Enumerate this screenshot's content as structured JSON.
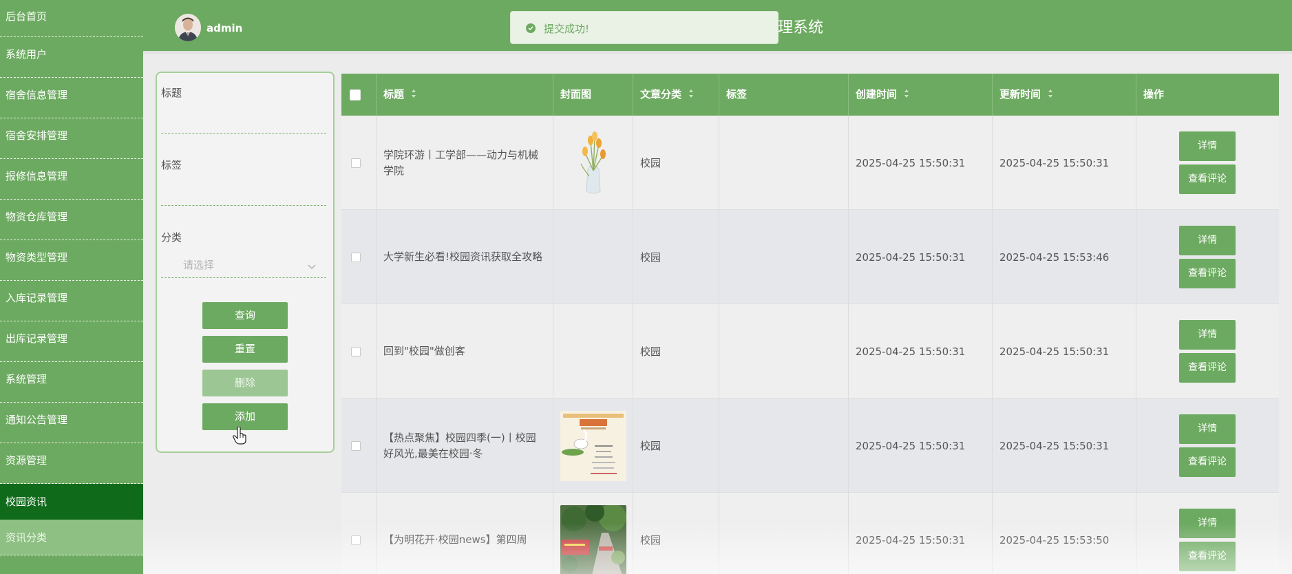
{
  "sidebar": {
    "items": [
      {
        "label": "后台首页"
      },
      {
        "label": "系统用户"
      },
      {
        "label": "宿舍信息管理"
      },
      {
        "label": "宿舍安排管理"
      },
      {
        "label": "报修信息管理"
      },
      {
        "label": "物资仓库管理"
      },
      {
        "label": "物资类型管理"
      },
      {
        "label": "入库记录管理"
      },
      {
        "label": "出库记录管理"
      },
      {
        "label": "系统管理"
      },
      {
        "label": "通知公告管理"
      },
      {
        "label": "资源管理"
      },
      {
        "label": "校园资讯"
      },
      {
        "label": "资讯分类"
      }
    ]
  },
  "header": {
    "username": "admin",
    "system_title": "理系统",
    "accent_color": "#6daa61"
  },
  "toast": {
    "message": "提交成功!",
    "type": "success"
  },
  "search": {
    "title_label": "标题",
    "tag_label": "标签",
    "category_label": "分类",
    "category_placeholder": "请选择",
    "buttons": {
      "query": "查询",
      "reset": "重置",
      "delete": "删除",
      "add": "添加"
    }
  },
  "table": {
    "columns": [
      "标题",
      "封面图",
      "文章分类",
      "标签",
      "创建时间",
      "更新时间",
      "操作"
    ],
    "rows": [
      {
        "title": "学院环游丨工学部——动力与机械学院",
        "cover": "tulip-vase",
        "category": "校园",
        "tag": "",
        "created": "2025-04-25 15:50:31",
        "updated": "2025-04-25 15:50:31"
      },
      {
        "title": "大学新生必看!校园资讯获取全攻略",
        "cover": "",
        "category": "校园",
        "tag": "",
        "created": "2025-04-25 15:50:31",
        "updated": "2025-04-25 15:53:46"
      },
      {
        "title": "回到\"校园\"做创客",
        "cover": "",
        "category": "校园",
        "tag": "",
        "created": "2025-04-25 15:50:31",
        "updated": "2025-04-25 15:50:31"
      },
      {
        "title": "【热点聚焦】校园四季(一)丨校园好风光,最美在校园·冬",
        "cover": "goose-poster",
        "category": "校园",
        "tag": "",
        "created": "2025-04-25 15:50:31",
        "updated": "2025-04-25 15:50:31"
      },
      {
        "title": "【为明花开·校园news】第四周",
        "cover": "campus-photo",
        "category": "校园",
        "tag": "",
        "created": "2025-04-25 15:50:31",
        "updated": "2025-04-25 15:53:50"
      }
    ],
    "actions": {
      "detail": "详情",
      "comments": "查看评论"
    }
  }
}
